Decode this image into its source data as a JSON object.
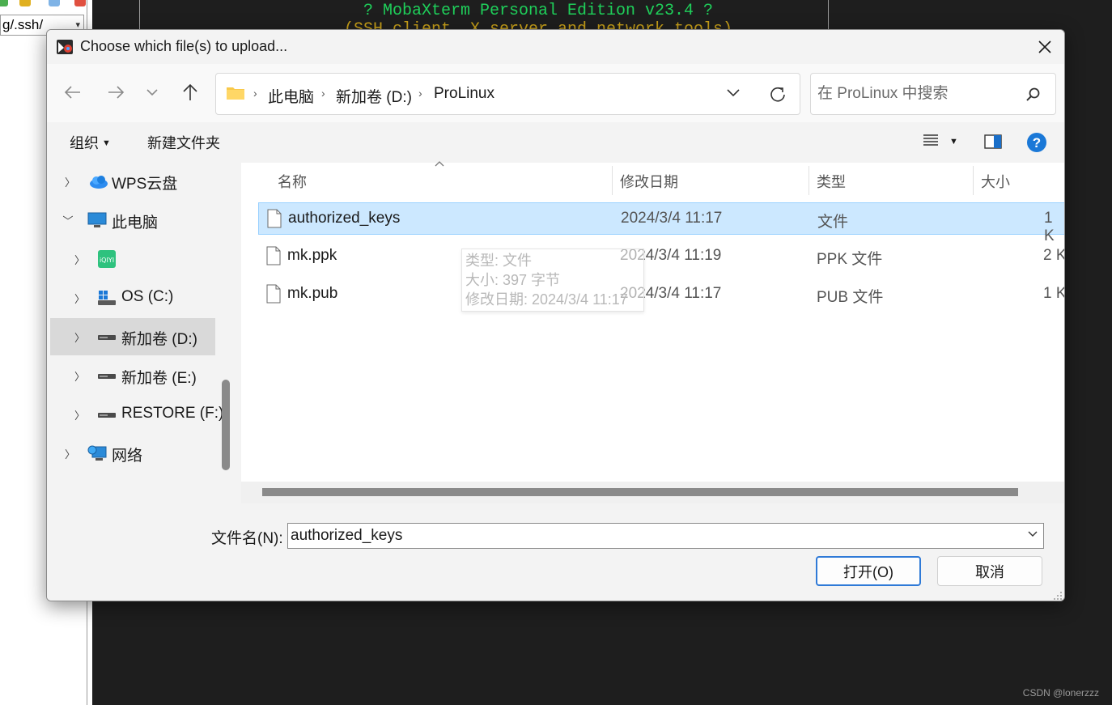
{
  "background_app": {
    "path_text": "g/.ssh/",
    "terminal_line1": "? MobaXterm Personal Edition v23.4 ?",
    "terminal_line2": "(SSH client, X server and network tools)",
    "watermark": "CSDN @lonerzzz"
  },
  "dialog": {
    "title": "Choose which file(s) to upload...",
    "breadcrumb": [
      "此电脑",
      "新加卷 (D:)",
      "ProLinux"
    ],
    "search_placeholder": "在 ProLinux 中搜索",
    "commands": {
      "organize": "组织",
      "new_folder": "新建文件夹"
    },
    "sidebar": {
      "items": [
        {
          "label": "WPS云盘",
          "icon": "wps-cloud-icon",
          "expanded": false
        },
        {
          "label": "此电脑",
          "icon": "computer-icon",
          "expanded": true
        },
        {
          "label": "",
          "icon": "iqiyi-app-icon",
          "expanded": false
        },
        {
          "label": "OS (C:)",
          "icon": "windows-drive-icon",
          "expanded": false
        },
        {
          "label": "新加卷 (D:)",
          "icon": "drive-icon",
          "expanded": false,
          "selected": true
        },
        {
          "label": "新加卷 (E:)",
          "icon": "drive-icon",
          "expanded": false
        },
        {
          "label": "RESTORE (F:)",
          "icon": "drive-icon",
          "expanded": false
        },
        {
          "label": "网络",
          "icon": "network-icon",
          "expanded": false
        }
      ]
    },
    "columns": {
      "name": "名称",
      "modified": "修改日期",
      "type": "类型",
      "size": "大小"
    },
    "files": [
      {
        "name": "authorized_keys",
        "modified": "2024/3/4 11:17",
        "type": "文件",
        "size": "1 K",
        "selected": true
      },
      {
        "name": "mk.ppk",
        "modified": "2024/3/4 11:19",
        "type": "PPK 文件",
        "size": "2 K",
        "selected": false
      },
      {
        "name": "mk.pub",
        "modified": "2024/3/4 11:17",
        "type": "PUB 文件",
        "size": "1 K",
        "selected": false
      }
    ],
    "tooltip": {
      "type": "类型: 文件",
      "size": "大小: 397 字节",
      "modified": "修改日期: 2024/3/4 11:17"
    },
    "filename_label": "文件名(N):",
    "filename_value": "authorized_keys",
    "open_button": "打开(O)",
    "cancel_button": "取消"
  },
  "colors": {
    "selection": "#cce8ff",
    "accent": "#2f7ad7",
    "terminal_green": "#1fcf5a",
    "terminal_yellow": "#c8a019"
  }
}
